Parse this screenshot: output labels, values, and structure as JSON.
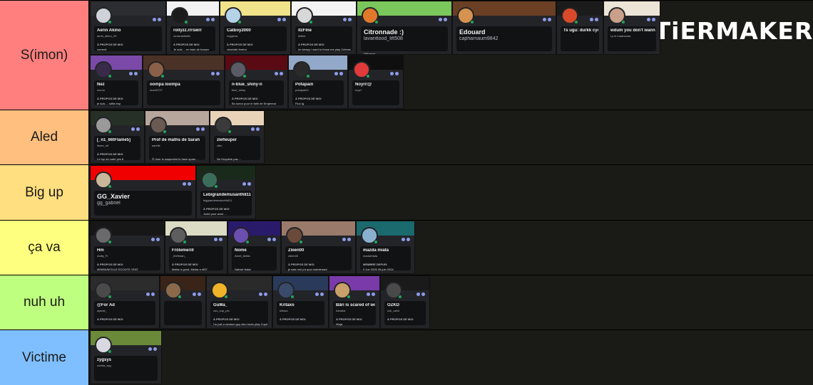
{
  "brand": {
    "logo_text": "TiERMAKER"
  },
  "tiers": [
    {
      "label": "S(imon)",
      "color": "#ff7f7f",
      "items": [
        {
          "name": "Aerin Akino",
          "user": "aerin_akino_03",
          "section": "À PROPOS DE MOI",
          "bio": "currentl",
          "banner": "#2b2d31",
          "avatar": "#cfd2d8"
        },
        {
          "name": "rollyzz.rrrswrr",
          "user": "mraurasthetic",
          "section": "À PROPOS DE MOI",
          "bio": "Je suis ... en train de bosser",
          "banner": "#f2f2f2",
          "avatar": "#1c1c1c"
        },
        {
          "name": "Catboy2000",
          "user": "mygiena",
          "section": "À PROPOS DE MOI",
          "bio": "charlotte fereira",
          "banner": "#f0e38a",
          "avatar": "#b6d2e8"
        },
        {
          "name": "itzFlne",
          "user": "itzflne",
          "section": "À PROPOS DE MOI",
          "bio": "Im sleepy i want to throw me play Celeste",
          "banner": "#f4f4f4",
          "avatar": "#d8d8d8"
        },
        {
          "name": "Citronnade :)",
          "user": "lavanttood_lift508",
          "section": "",
          "bio": "l'Wheeze",
          "banner": "#7ac75c",
          "avatar": "#e07a2a"
        },
        {
          "name": "Edouard",
          "user": "capharnaum9842",
          "section": "",
          "bio": "",
          "banner": "#6a3f24",
          "avatar": "#d6934f"
        },
        {
          "name": "Ts ugu: durkk cyc't are!",
          "user": "",
          "section": "",
          "bio": "",
          "banner": "#1b1b1b",
          "avatar": "#d84a2a"
        },
        {
          "name": "wdum you don't wanna",
          "user": "Ly le maancaaa",
          "section": "",
          "bio": "",
          "banner": "#ece4d6",
          "avatar": "#c9a08a"
        },
        {
          "name": "Nez",
          "user": "nez.la",
          "section": "À PROPOS DE MOI",
          "bio": "je suis ... sdfla trop",
          "banner": "#7b4aa8",
          "avatar": "#3a2a4a"
        },
        {
          "name": "oompa loompa",
          "user": "mom0727",
          "section": "",
          "bio": "",
          "banner": "#4b3226",
          "avatar": "#8a6048"
        },
        {
          "name": "n-blue_shiny-n",
          "user": "blue_shiny",
          "section": "À PROPOS DE MOI",
          "bio": "Bo lumor pour le faith de Empereur",
          "banner": "#5a0a12",
          "avatar": "#5b5b66"
        },
        {
          "name": "Potapain",
          "user": "pokapain3",
          "section": "À PROPOS DE MOI",
          "bio": "Fluo Ig",
          "banner": "#93a9c9",
          "avatar": "#2a2a2a"
        },
        {
          "name": "Noyri!@",
          "user": "noyri",
          "section": "",
          "bio": "",
          "banner": "#0f0f0f",
          "avatar": "#e03a3a"
        }
      ]
    },
    {
      "label": "Aled",
      "color": "#ffbf7f",
      "items": [
        {
          "name": "[_n1_66tFlame5]",
          "user": "itsme_luf",
          "section": "À PROPOS DE MOI",
          "bio": "Le top du cube yes tt",
          "banner": "#263026",
          "avatar": "#9a9a9a"
        },
        {
          "name": "Prof de maths de Sarah",
          "user": "sarelle",
          "section": "",
          "bio": "Ô User is suspected to have spam ...",
          "banner": "#b7a69c",
          "avatar": "#6a5a52"
        },
        {
          "name": "zlefleuper",
          "user": "zlbu",
          "section": "",
          "bio": "Ne t'inquiète pas ...",
          "banner": "#e8d3b9",
          "avatar": "#3a3a3a"
        }
      ]
    },
    {
      "label": "Big up",
      "color": "#ffdf7f",
      "items": [
        {
          "name": "GG_Xavier",
          "user": "gg_gabriel",
          "section": "",
          "bio": "",
          "banner": "#f00000",
          "avatar": "#c9b79a"
        },
        {
          "name": "Lebigrandemusanth811",
          "user": "biggrandemusiceth811",
          "section": "À PROPOS DE MOI",
          "bio": "Juste pour avoir ...",
          "banner": "#1a2a1a",
          "avatar": "#3b6e5a"
        }
      ]
    },
    {
      "label": "ça va",
      "color": "#ffff7f",
      "items": [
        {
          "name": "Hm",
          "user": "really_Fl",
          "section": "À PROPOS DE MOI",
          "bio": "MINIMUM ELLE ECOUTE YEAT",
          "banner": "#171717",
          "avatar": "#6a6a6a"
        },
        {
          "name": "Frôlemerill",
          "user": "_frlefiman_",
          "section": "À PROPOS DE MOI",
          "bio": "Meliar a good, Meliar a r657",
          "banner": "#dcdcc4",
          "avatar": "#5e5e5e"
        },
        {
          "name": "Nomé",
          "user": "Ahret_ikiblis",
          "section": "",
          "bio": "Nahwé Kalai",
          "banner": "#2a1a6a",
          "avatar": "#6a4fb0"
        },
        {
          "name": "Zleen00",
          "user": "zleen00",
          "section": "À PROPOS DE MOI",
          "bio": "je sais moi y'a quoi maintenant",
          "banner": "#9a7a6a",
          "avatar": "#6a4a3a"
        },
        {
          "name": "mazda miata",
          "user": "madarhiata",
          "section": "MEMBRE DEPUIS",
          "bio": "9 Jun 2020  26 juin 2024",
          "banner": "#1a6a6e",
          "avatar": "#8ab0d0"
        }
      ]
    },
    {
      "label": "nuh uh",
      "color": "#bfff7f",
      "items": [
        {
          "name": "@For Ad",
          "user": "ayscal_",
          "section": "À PROPOS DE MOI",
          "bio": "",
          "banner": "#2c2c2c",
          "avatar": "#4a4a4a"
        },
        {
          "name": "",
          "user": "",
          "section": "",
          "bio": "",
          "banner": "#3a2418",
          "avatar": "#8a6a4a"
        },
        {
          "name": "GuMa_",
          "user": "osu_cup_pio",
          "section": "À PROPOS DE MOI",
          "bio": "I'm just a random guy who loves play Cuphead",
          "banner": "#2a2a2a",
          "avatar": "#f0b32a"
        },
        {
          "name": "Kritaxo",
          "user": "kritaxo",
          "section": "À PROPOS DE MOI",
          "bio": "",
          "banner": "#2a3a5a",
          "avatar": "#3a4a6a"
        },
        {
          "name": "Bâri is scared of women",
          "user": "hahaha",
          "section": "À PROPOS DE MOI",
          "bio": "Ninja",
          "banner": "#7a3aaa",
          "avatar": "#c9a06a"
        },
        {
          "name": "OZKD",
          "user": "ozk_ozkd",
          "section": "À PROPOS DE MOI",
          "bio": "",
          "banner": "#1a1a1a",
          "avatar": "#4a4a4a"
        }
      ]
    },
    {
      "label": "Victime",
      "color": "#7fbfff",
      "items": [
        {
          "name": "zygsys",
          "user": "zzzsla_zyg",
          "section": "",
          "bio": "",
          "banner": "#6a8a3a",
          "avatar": "#d8d8e0"
        }
      ]
    }
  ]
}
